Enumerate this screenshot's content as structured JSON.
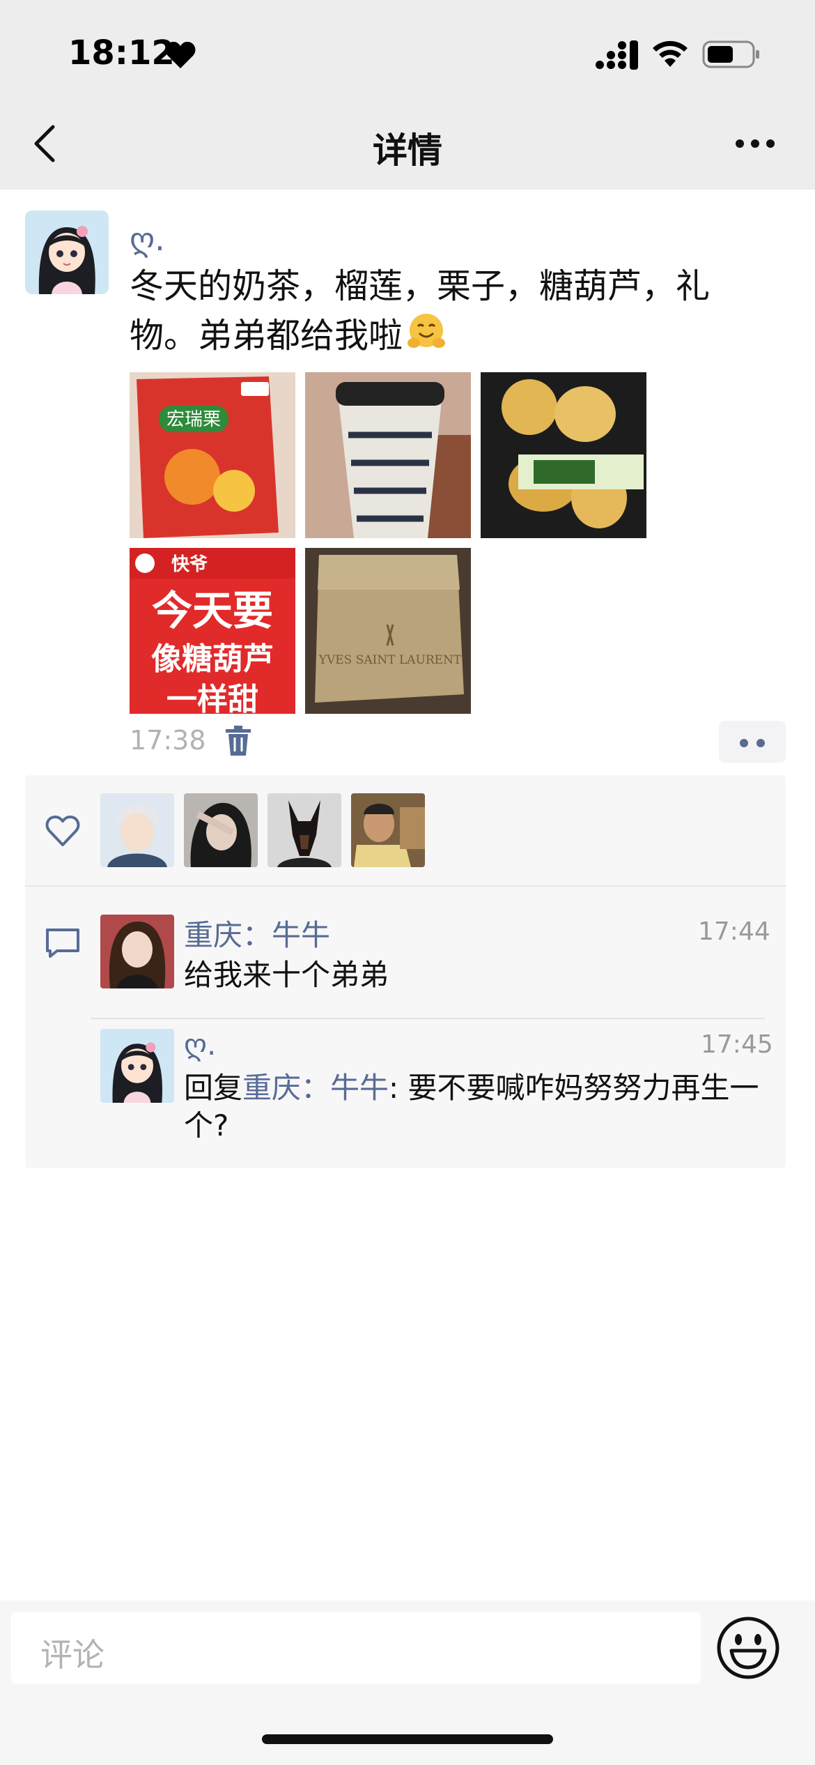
{
  "status_bar": {
    "time": "18:12",
    "heart_icon": "heart-icon",
    "signal_icon": "signal-icon",
    "wifi_icon": "wifi-icon",
    "battery_icon": "battery-icon"
  },
  "nav": {
    "title": "详情",
    "back_icon": "chevron-left-icon",
    "more_icon": "more-dots-icon"
  },
  "post": {
    "author": "ღ.",
    "text": "冬天的奶茶，榴莲，栗子，糖葫芦，礼物。弟弟都给我啦",
    "emoji": "hugging-face-emoji",
    "images": [
      {
        "name": "chestnut-bag-photo",
        "caption": "宏瑞栗"
      },
      {
        "name": "milk-tea-cup-photo",
        "caption": ""
      },
      {
        "name": "durian-box-photo",
        "caption": ""
      },
      {
        "name": "candied-haw-bag-photo",
        "caption": "今天要 像糖葫芦 一样甜"
      },
      {
        "name": "ysl-gift-box-photo",
        "caption": "YVES SAINT LAURENT"
      }
    ],
    "time": "17:38",
    "delete_icon": "trash-icon",
    "options_icon": "more-dots-icon"
  },
  "likes": {
    "icon": "heart-outline-icon",
    "avatars": [
      "liker-avatar-1",
      "liker-avatar-2",
      "liker-avatar-3",
      "liker-avatar-4"
    ]
  },
  "comments": {
    "icon": "comment-icon",
    "items": [
      {
        "name": "重庆：牛牛",
        "time": "17:44",
        "text": "给我来十个弟弟"
      },
      {
        "name": "ღ.",
        "time": "17:45",
        "reply_prefix": "回复",
        "reply_to": "重庆：牛牛",
        "text": ": 要不要喊咋妈努努力再生一个?"
      }
    ]
  },
  "input_bar": {
    "placeholder": "评论",
    "emoji_icon": "smiley-icon"
  },
  "colors": {
    "link": "#576b95",
    "nav_bg": "#ededed",
    "panel_bg": "#f7f7f7"
  }
}
